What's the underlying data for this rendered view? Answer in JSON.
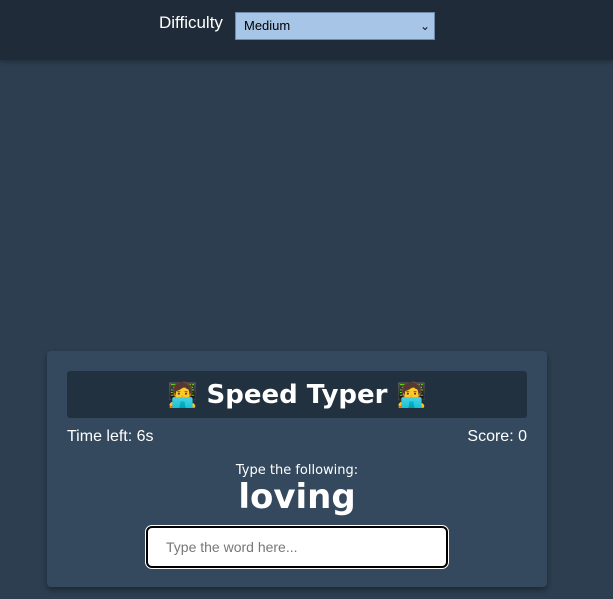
{
  "header": {
    "difficulty_label": "Difficulty",
    "difficulty_selected": "Medium"
  },
  "game": {
    "title": "Speed Typer",
    "title_icon": "technologist-emoji",
    "time_left": "Time left: 6s",
    "score": "Score: 0",
    "prompt": "Type the following:",
    "word": "loving",
    "input_placeholder": "Type the word here...",
    "input_value": ""
  },
  "colors": {
    "background": "#2c3e50",
    "topbar": "#1f2b38",
    "card": "#34495e",
    "title_bar": "#223140",
    "select_bg": "#a7c5e6"
  }
}
